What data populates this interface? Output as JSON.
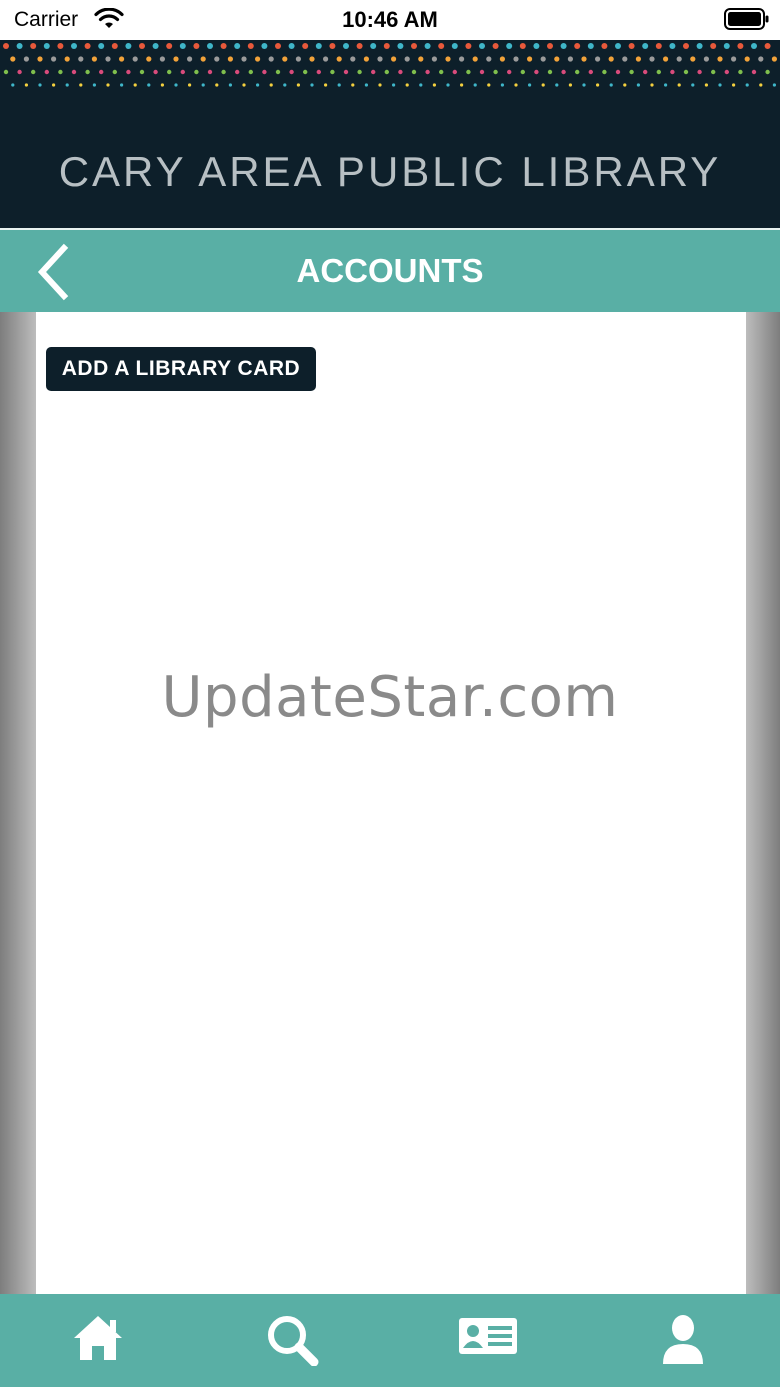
{
  "status_bar": {
    "carrier": "Carrier",
    "time": "10:46 AM"
  },
  "banner": {
    "title": "CARY AREA PUBLIC LIBRARY"
  },
  "nav": {
    "title": "ACCOUNTS",
    "back_icon": "chevron-left-icon"
  },
  "content": {
    "add_card_label": "ADD A LIBRARY CARD"
  },
  "watermark": {
    "text": "UpdateStar.com"
  },
  "tab_bar": {
    "tabs": [
      {
        "icon": "home-icon"
      },
      {
        "icon": "search-icon"
      },
      {
        "icon": "library-card-icon"
      },
      {
        "icon": "profile-icon"
      }
    ]
  },
  "colors": {
    "banner_bg": "#0d1f2a",
    "accent": "#59afa5",
    "button_bg": "#0d1f2a",
    "dot_colors": [
      "#e8593b",
      "#f2a33a",
      "#7fbf4d",
      "#3fb6c9",
      "#9b9b9b",
      "#d94b7b",
      "#f4d03f"
    ]
  }
}
